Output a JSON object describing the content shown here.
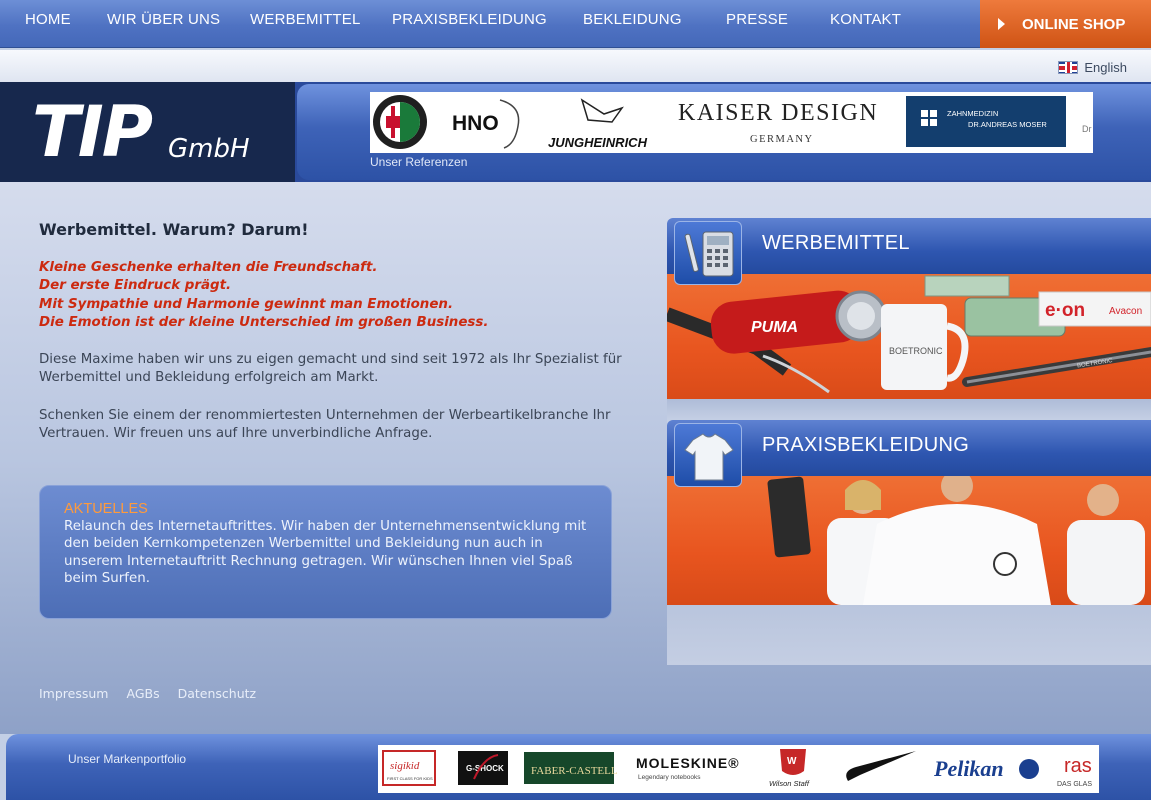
{
  "nav": {
    "items": [
      "HOME",
      "WIR ÜBER UNS",
      "WERBEMITTEL",
      "PRAXISBEKLEIDUNG",
      "BEKLEIDUNG",
      "PRESSE",
      "KONTAKT"
    ],
    "shop_label": "ONLINE SHOP"
  },
  "language": {
    "label": "English"
  },
  "header": {
    "logo_main": "TIP",
    "logo_sub": "GmbH",
    "references_label": "Unser Referenzen",
    "references": {
      "hno": "HNO",
      "jungheinrich": "JUNGHEINRICH",
      "kaiser_line1": "KAISER DESIGN",
      "kaiser_line2": "GERMANY",
      "zahn_line1": "ZAHNMEDIZIN",
      "zahn_line2": "DR.ANDREAS MOSER",
      "cut": "Dr"
    }
  },
  "main": {
    "headline": "Werbemittel. Warum? Darum!",
    "quotes": [
      "Kleine Geschenke erhalten die Freundschaft.",
      "Der erste Eindruck prägt.",
      "Mit Sympathie und Harmonie gewinnt man Emotionen.",
      "Die Emotion ist der kleine Unterschied im großen Business."
    ],
    "para1": "Diese Maxime haben wir uns zu eigen gemacht und sind seit 1972 als Ihr Spezialist für Werbemittel und Bekleidung erfolgreich am Markt.",
    "para2": "Schenken Sie einem der renommiertesten Unternehmen der Werbeartikelbranche Ihr Vertrauen. Wir freuen uns auf Ihre unverbindliche Anfrage.",
    "news": {
      "title": "AKTUELLES",
      "text": "Relaunch des Internetauftrittes. Wir haben der Unternehmensentwicklung mit den beiden Kernkompetenzen Werbemittel und Bekleidung nun auch in unserem Internetauftritt Rechnung getragen. Wir wünschen Ihnen viel Spaß beim Surfen."
    }
  },
  "footer": {
    "links": [
      "Impressum",
      "AGBs",
      "Datenschutz"
    ]
  },
  "teasers": {
    "werbemittel": {
      "title": "WERBEMITTEL",
      "puma": "PUMA",
      "eon": "e·on",
      "avacon": "Avacon",
      "boetron": "BOETRONIC",
      "boetron_pen": "BOETRONIC"
    },
    "praxis": {
      "title": "PRAXISBEKLEIDUNG"
    }
  },
  "brands": {
    "label": "Unser Markenportfolio",
    "items": {
      "sigikid": "sigikid",
      "sigikid_sub": "FIRST CLASS FOR KIDS",
      "gshock": "G-SHOCK",
      "faber": "FABER-CASTELL",
      "moleskine": "MOLESKINE®",
      "moleskine_sub": "Legendary notebooks",
      "wilson": "W",
      "wilson_sub": "Wilson Staff",
      "pelikan": "Pelikan",
      "rast": "ras",
      "rast_sub": "DAS GLAS"
    }
  },
  "colors": {
    "nav": "#4f72c2",
    "shop": "#e0632a",
    "logo_bg": "#17284d",
    "quote": "#cc2a10",
    "news_title": "#ff9a3c",
    "teaser_photo": "#e8551f"
  }
}
